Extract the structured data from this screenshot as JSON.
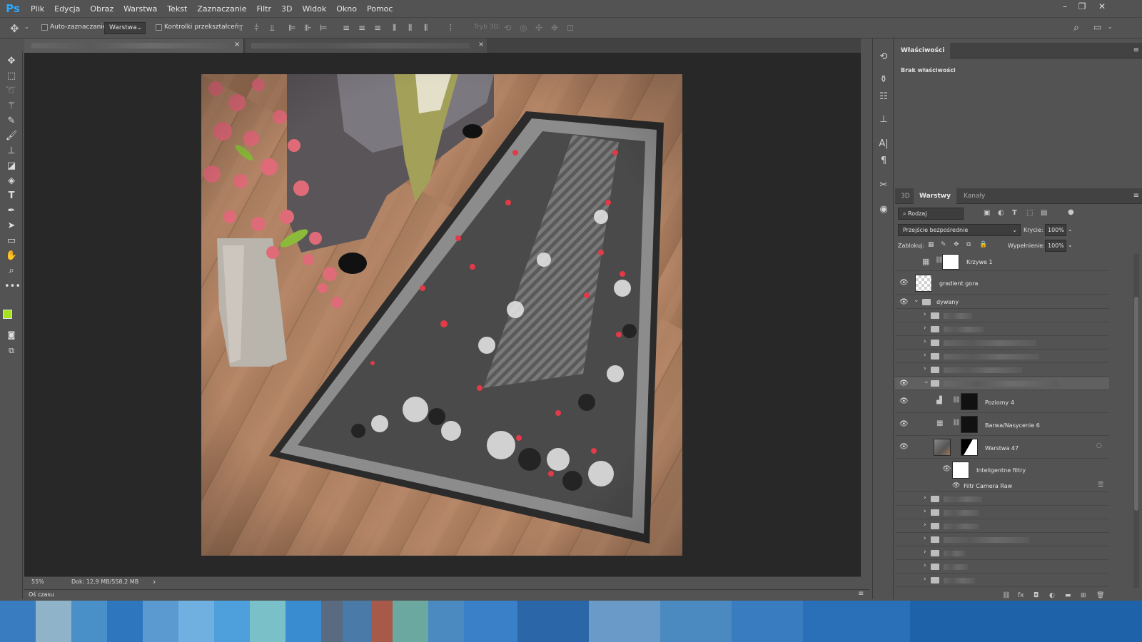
{
  "app": {
    "logo": "Ps"
  },
  "menu": [
    "Plik",
    "Edycja",
    "Obraz",
    "Warstwa",
    "Tekst",
    "Zaznaczanie",
    "Filtr",
    "3D",
    "Widok",
    "Okno",
    "Pomoc"
  ],
  "options": {
    "auto_select_label": "Auto-zaznaczanie:",
    "auto_select_target": "Warstwa",
    "transform_controls_label": "Kontrolki przekształceń",
    "mode_3d_label": "Tryb 3D:"
  },
  "tabs": [
    "×",
    "×"
  ],
  "status": {
    "zoom": "55%",
    "doc_size": "Dok: 12,9 MB/558,2 MB",
    "arrow": "›"
  },
  "timeline": {
    "label": "Oś czasu"
  },
  "properties": {
    "tab": "Właściwości",
    "empty": "Brak właściwości"
  },
  "layers_panel": {
    "tabs": [
      "3D",
      "Warstwy",
      "Kanały"
    ],
    "filter_kind": "Rodzaj",
    "blend_mode": "Przejście bezpośrednie",
    "opacity_label": "Krycie:",
    "opacity_value": "100%",
    "lock_label": "Zablokuj:",
    "fill_label": "Wypełnienie:",
    "fill_value": "100%",
    "layers": [
      {
        "name": "Krzywe 1"
      },
      {
        "name": "gradient gora"
      },
      {
        "name": "dywany"
      },
      {
        "name": "Poziomy 4"
      },
      {
        "name": "Barwa/Nasycenie 6"
      },
      {
        "name": "Warstwa 47"
      },
      {
        "name": "Inteligentne filtry"
      },
      {
        "name": "Filtr Camera Raw"
      }
    ]
  },
  "colors": {
    "foreground": "#a6e21f",
    "background": "#000000",
    "accent": "#31a8ff"
  },
  "icons": [
    "move-icon",
    "marquee-icon",
    "lasso-icon",
    "magic-wand-icon",
    "eyedropper-icon",
    "brush-icon",
    "stamp-icon",
    "eraser-icon",
    "bucket-icon",
    "type-icon",
    "pen-icon",
    "path-select-icon",
    "rectangle-icon",
    "hand-icon",
    "zoom-icon",
    "more-icon",
    "eye-icon",
    "folder-icon",
    "search-icon",
    "workspace-icon"
  ]
}
